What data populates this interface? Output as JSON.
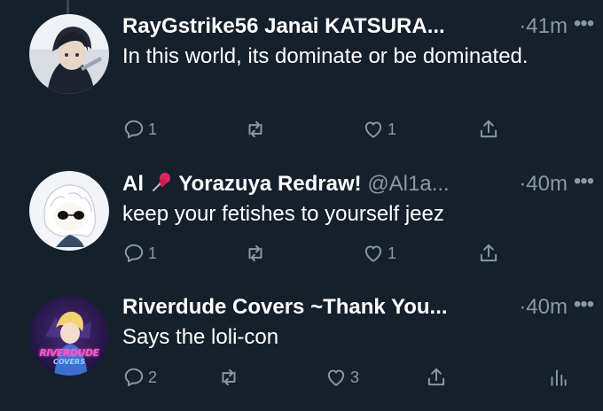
{
  "tweets": [
    {
      "name": "RayGstrike56 Janai KATSURA...",
      "handle": "",
      "time": "·41m",
      "text": "In this world, its dominate or be dominated.",
      "replies": "1",
      "retweets": "",
      "likes": "1",
      "avatar_icon": "anime-character-avatar",
      "action_icons": [
        "reply-icon",
        "retweet-icon",
        "like-icon",
        "share-icon"
      ]
    },
    {
      "name": "Al",
      "name_icon": "pushpin-emoji",
      "name_after": "Yorazuya Redraw!",
      "handle": "@Al1a...",
      "time": "·40m",
      "text": "keep your fetishes to yourself jeez",
      "replies": "1",
      "retweets": "",
      "likes": "1",
      "avatar_icon": "white-haired-character-avatar",
      "action_icons": [
        "reply-icon",
        "retweet-icon",
        "like-icon",
        "share-icon"
      ]
    },
    {
      "name": "Riverdude Covers ~Thank You...",
      "handle": "",
      "time": "·40m",
      "text": "Says the loli-con",
      "replies": "2",
      "retweets": "",
      "likes": "3",
      "avatar_icon": "riverdude-covers-logo-avatar",
      "avatar_logo_line1": "RIVERDUDE",
      "avatar_logo_line2": "COVERS",
      "action_icons": [
        "reply-icon",
        "retweet-icon",
        "like-icon",
        "share-icon",
        "analytics-icon"
      ]
    }
  ],
  "more_label": "•••",
  "colors": {
    "background": "#15202b",
    "text_primary": "#ffffff",
    "text_secondary": "#8899a6",
    "divider": "#38444d"
  }
}
